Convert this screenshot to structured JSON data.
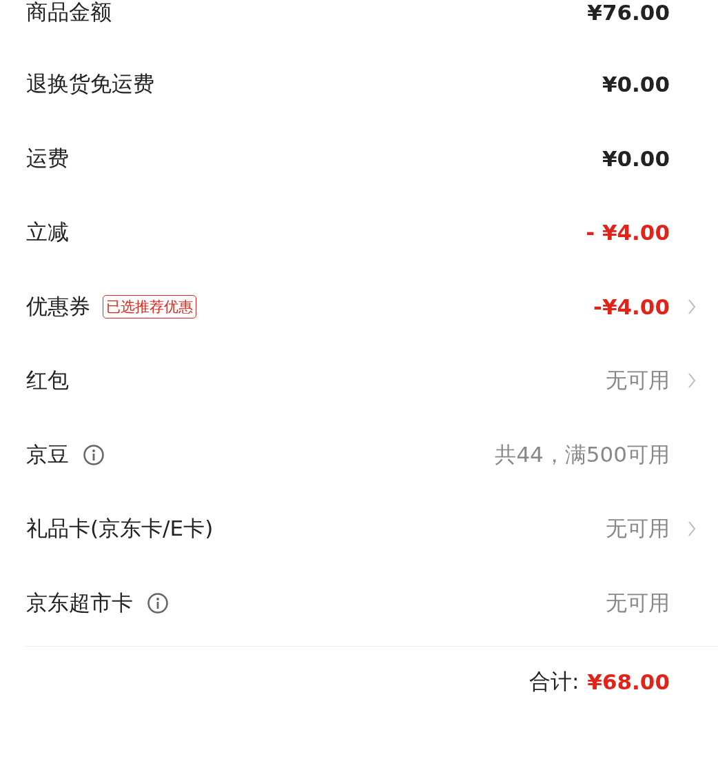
{
  "rows": [
    {
      "label": "商品金额",
      "value": "¥76.00",
      "kind": "normal",
      "info": false,
      "arrow": false
    },
    {
      "label": "退换货免运费",
      "value": "¥0.00",
      "kind": "normal",
      "info": false,
      "arrow": false
    },
    {
      "label": "运费",
      "value": "¥0.00",
      "kind": "normal",
      "info": false,
      "arrow": false
    },
    {
      "label": "立减",
      "value": "- ¥4.00",
      "kind": "discount",
      "info": false,
      "arrow": false
    },
    {
      "label": "优惠券",
      "badge": "已选推荐优惠",
      "value": "-¥4.00",
      "kind": "discount",
      "info": false,
      "arrow": true
    },
    {
      "label": "红包",
      "value": "无可用",
      "kind": "muted",
      "info": false,
      "arrow": true
    },
    {
      "label": "京豆",
      "value": "共44，满500可用",
      "kind": "muted",
      "info": true,
      "arrow": false
    },
    {
      "label": "礼品卡(京东卡/E卡)",
      "value": "无可用",
      "kind": "muted",
      "info": false,
      "arrow": true
    },
    {
      "label": "京东超市卡",
      "value": "无可用",
      "kind": "muted",
      "info": true,
      "arrow": false
    }
  ],
  "total": {
    "label": "合计:",
    "value": "¥68.00"
  }
}
